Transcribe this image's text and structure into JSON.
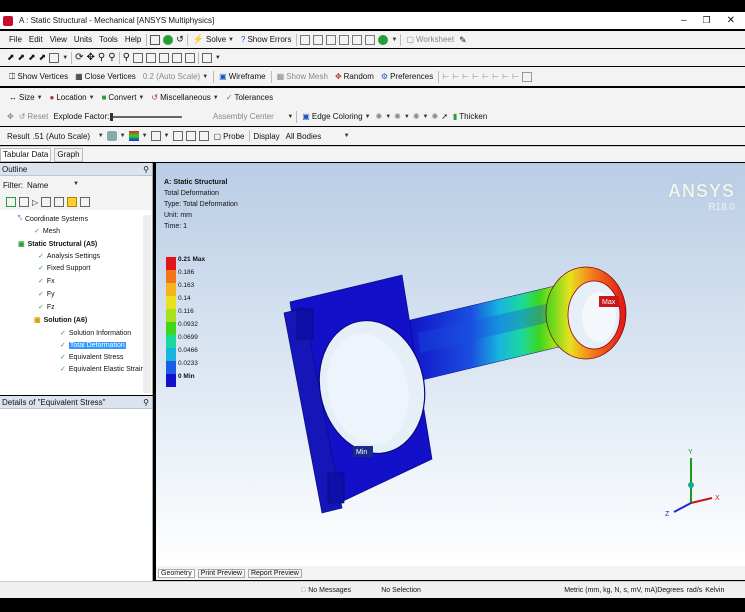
{
  "title_bar": {
    "title": "A : Static Structural - Mechanical [ANSYS Multiphysics]"
  },
  "menu": {
    "items": [
      "File",
      "Edit",
      "View",
      "Units",
      "Tools",
      "Help"
    ],
    "solve_label": "Solve",
    "show_errors_label": "Show Errors",
    "worksheet_label": "Worksheet"
  },
  "toolbar_graphics": {
    "show_vertices": "Show Vertices",
    "close_vertices": "Close Vertices",
    "auto_scale": "0.2 (Auto Scale)",
    "wireframe": "Wireframe",
    "show_mesh": "Show Mesh",
    "random": "Random",
    "preferences": "Preferences"
  },
  "toolbar_context": {
    "size": "Size",
    "location": "Location",
    "convert": "Convert",
    "miscellaneous": "Miscellaneous",
    "tolerances": "Tolerances"
  },
  "toolbar_explode": {
    "reset": "Reset",
    "explode_factor": "Explode Factor:",
    "assembly_center": "Assembly Center",
    "edge_coloring": "Edge Coloring",
    "thicken": "Thicken"
  },
  "toolbar_result": {
    "result_label": "Result",
    "result_scale": ".51 (Auto Scale)",
    "probe": "Probe",
    "display_label": "Display",
    "display_value": "All Bodies"
  },
  "tabs_top": [
    "Tabular Data",
    "Graph"
  ],
  "outline": {
    "header": "Outline",
    "filter_label": "Filter:",
    "filter_value": "Name",
    "tree": [
      {
        "label": "Coordinate Systems",
        "bold": false
      },
      {
        "label": "Mesh",
        "bold": false
      },
      {
        "label": "Static Structural (A5)",
        "bold": true
      },
      {
        "label": "Analysis Settings",
        "bold": false
      },
      {
        "label": "Fixed Support",
        "bold": false
      },
      {
        "label": "Fx",
        "bold": false
      },
      {
        "label": "Fy",
        "bold": false
      },
      {
        "label": "Fz",
        "bold": false
      },
      {
        "label": "Solution (A6)",
        "bold": true
      },
      {
        "label": "Solution Information",
        "bold": false
      },
      {
        "label": "Total Deformation",
        "bold": false
      },
      {
        "label": "Equivalent Stress",
        "bold": false
      },
      {
        "label": "Equivalent Elastic Strain",
        "bold": false
      }
    ]
  },
  "details": {
    "header": "Details of \"Equivalent Stress\""
  },
  "viewport": {
    "info": [
      "A: Static Structural",
      "Total Deformation",
      "Type: Total Deformation",
      "Unit: mm",
      "Time: 1"
    ],
    "brand": "ANSYS",
    "version": "R18.0",
    "legend": [
      {
        "label": "0.21 Max",
        "color": "#e0141a"
      },
      {
        "label": "0.186",
        "color": "#f2741b"
      },
      {
        "label": "0.163",
        "color": "#f5b31e"
      },
      {
        "label": "0.14",
        "color": "#e9e11f"
      },
      {
        "label": "0.116",
        "color": "#a7e11d"
      },
      {
        "label": "0.0932",
        "color": "#3fd61c"
      },
      {
        "label": "0.0699",
        "color": "#1bd8a0"
      },
      {
        "label": "0.0466",
        "color": "#18b4e0"
      },
      {
        "label": "0.0233",
        "color": "#1a5ee6"
      },
      {
        "label": "0 Min",
        "color": "#1210c8"
      }
    ],
    "max_tag": "Max",
    "min_tag": "Min",
    "axes": {
      "x": "X",
      "y": "Y",
      "z": "Z"
    }
  },
  "bottom_tabs": [
    "Geometry",
    "Print Preview",
    "Report Preview"
  ],
  "status_bar": {
    "messages": "No Messages",
    "selection": "No Selection",
    "units": "Metric (mm, kg, N, s, mV, mA)",
    "angle": "Degrees",
    "rot": "rad/s",
    "temp": "Kelvin"
  },
  "colors": {
    "panel_bg": "#f3f3f3",
    "viewport_top": "#bcd0e6",
    "viewport_bottom": "#ffffff",
    "selection": "#3399ff",
    "ansys_red": "#c8102e"
  }
}
